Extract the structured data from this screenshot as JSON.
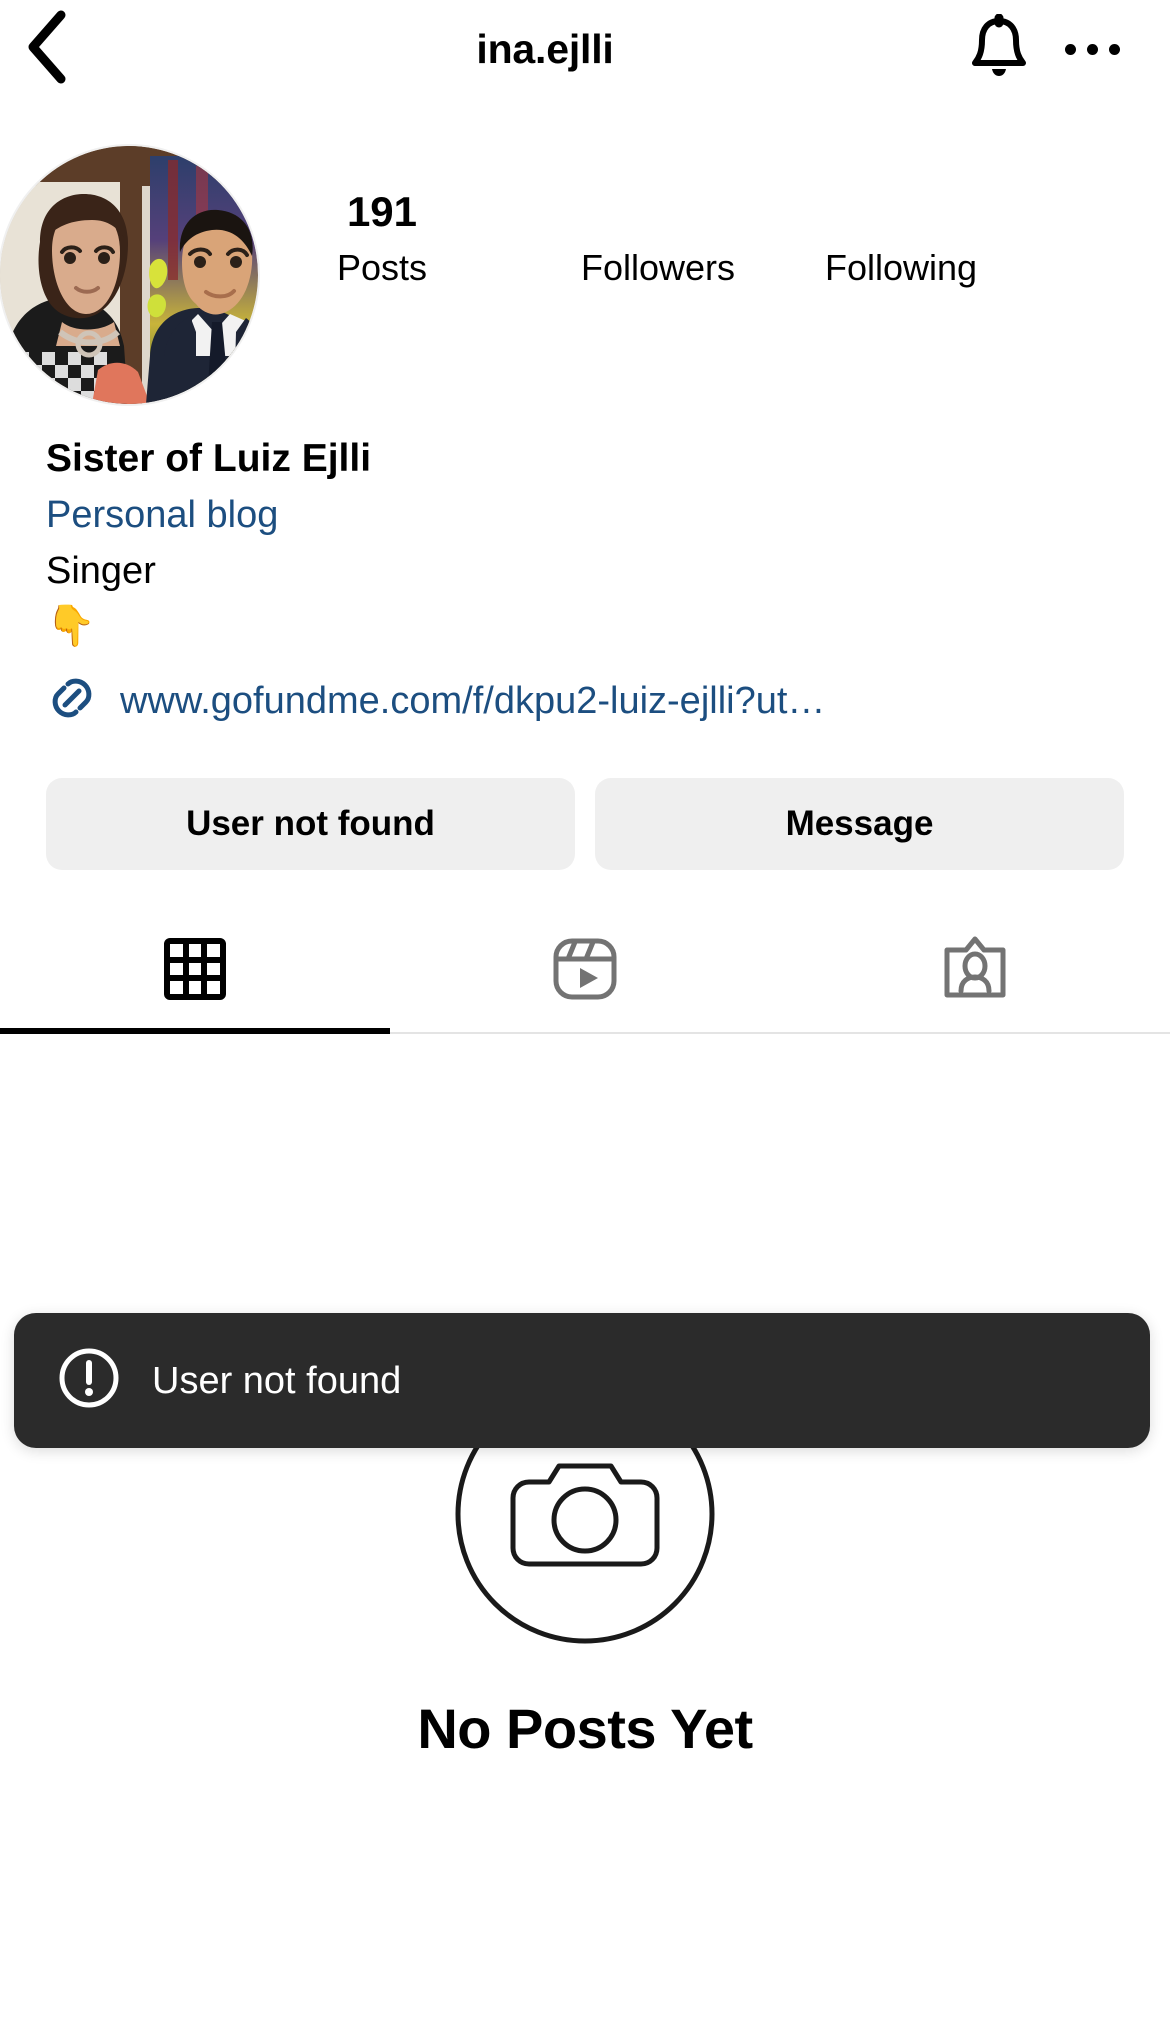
{
  "header": {
    "title": "ina.ejlli",
    "back_icon": "chevron-left-icon",
    "notifications_icon": "bell-icon",
    "more_icon": "more-options-icon"
  },
  "profile": {
    "avatar_alt": "profile-photo",
    "stats": [
      {
        "key": "posts",
        "value": "191",
        "label": "Posts"
      },
      {
        "key": "followers",
        "value": "",
        "label": "Followers"
      },
      {
        "key": "following",
        "value": "",
        "label": "Following"
      }
    ],
    "bio": {
      "name": "Sister of Luiz Ejlli",
      "category": "Personal blog",
      "text": "Singer",
      "emoji": "👇",
      "link_icon": "link-chain-icon",
      "link_text": "www.gofundme.com/f/dkpu2-luiz-ejlli?ut…"
    },
    "actions": [
      {
        "key": "follow",
        "label": "User not found"
      },
      {
        "key": "message",
        "label": "Message"
      }
    ]
  },
  "tabs": [
    {
      "key": "grid",
      "icon": "grid-icon",
      "active": true
    },
    {
      "key": "reels",
      "icon": "reels-icon",
      "active": false
    },
    {
      "key": "tagged",
      "icon": "tagged-icon",
      "active": false
    }
  ],
  "empty_state": {
    "icon": "camera-circle-icon",
    "title": "No Posts Yet"
  },
  "toast": {
    "icon": "exclamation-circle-icon",
    "message": "User not found"
  },
  "colors": {
    "accent_link": "#1c4e80",
    "button_bg": "#efefef",
    "toast_bg": "#2b2b2b",
    "tab_inactive": "#737373",
    "background": "#ffffff"
  }
}
